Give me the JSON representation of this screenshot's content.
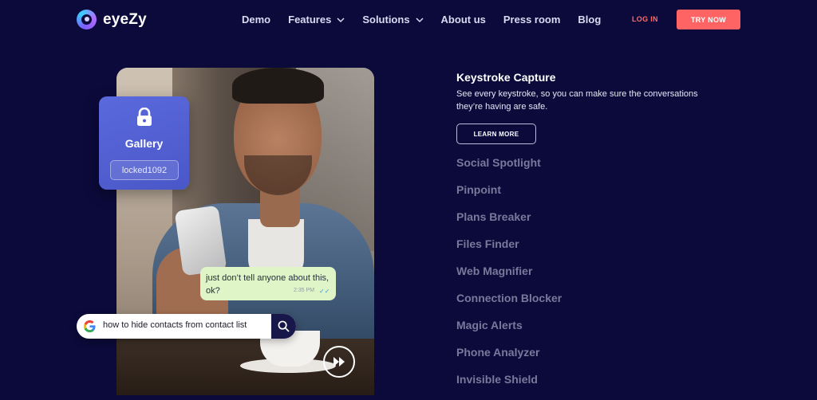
{
  "brand": {
    "name": "eyeZy"
  },
  "nav": {
    "items": [
      {
        "label": "Demo",
        "dropdown": false
      },
      {
        "label": "Features",
        "dropdown": true
      },
      {
        "label": "Solutions",
        "dropdown": true
      },
      {
        "label": "About us",
        "dropdown": false
      },
      {
        "label": "Press room",
        "dropdown": false
      },
      {
        "label": "Blog",
        "dropdown": false
      }
    ],
    "login": "LOG IN",
    "try_now": "TRY NOW"
  },
  "hero": {
    "gallery_card": {
      "title": "Gallery",
      "password": "locked1092"
    },
    "chat": {
      "message": "just don’t tell anyone about this, ok?",
      "time": "2:35 PM"
    },
    "search": {
      "query": "how to hide contacts from contact list"
    }
  },
  "feature": {
    "title": "Keystroke Capture",
    "description": "See every keystroke, so you can make sure the conversations they’re having are safe.",
    "cta": "LEARN MORE"
  },
  "feature_list": [
    "Social Spotlight",
    "Pinpoint",
    "Plans Breaker",
    "Files Finder",
    "Web Magnifier",
    "Connection Blocker",
    "Magic Alerts",
    "Phone Analyzer",
    "Invisible Shield"
  ],
  "colors": {
    "background": "#0b0a3a",
    "accent": "#ff6464",
    "card": "#5a69dc",
    "inactive_text": "#777a9b"
  }
}
